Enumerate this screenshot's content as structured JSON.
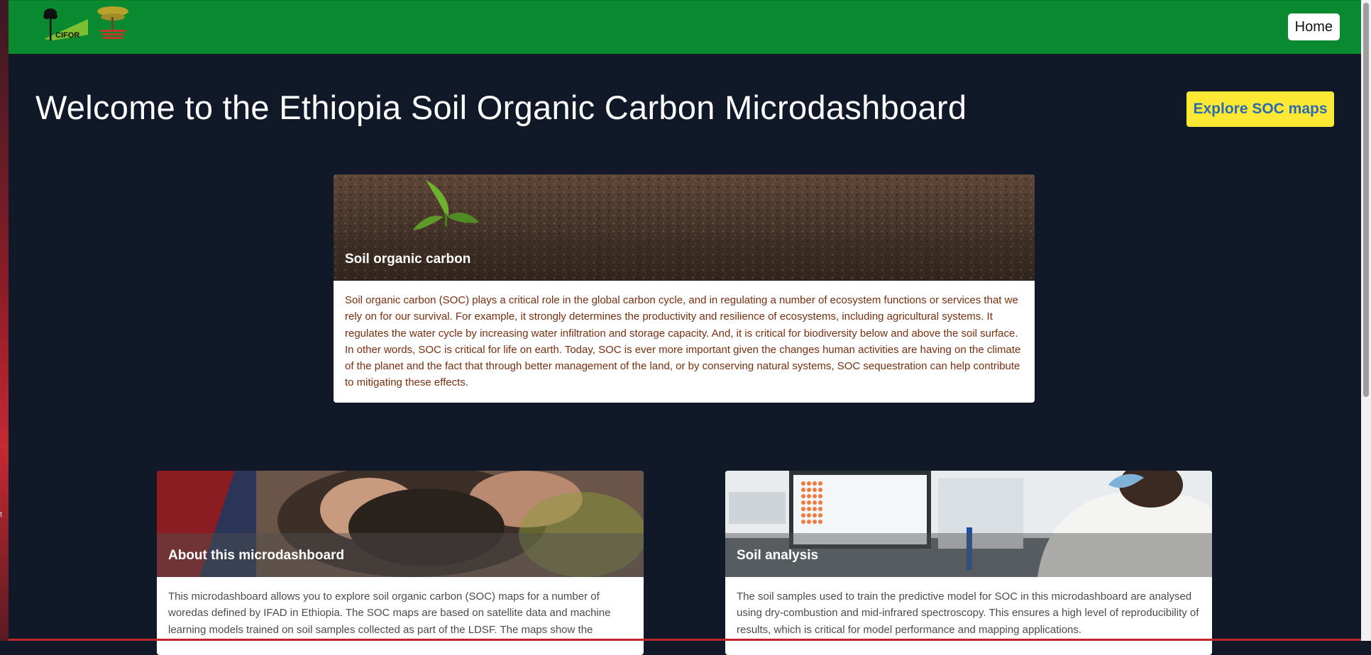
{
  "navbar": {
    "logo_cifor_text": "CIFOR",
    "home_label": "Home"
  },
  "hero": {
    "title": "Welcome to the Ethiopia Soil Organic Carbon Microdashboard",
    "explore_label": "Explore SOC maps"
  },
  "cards": {
    "soc": {
      "title": "Soil organic carbon",
      "text": "Soil organic carbon (SOC) plays a critical role in the global carbon cycle, and in regulating a number of ecosystem functions or services that we rely on for our survival. For example, it strongly determines the productivity and resilience of ecosystems, including agricultural systems. It regulates the water cycle by increasing water infiltration and storage capacity. And, it is critical for biodiversity below and above the soil surface. In other words, SOC is critical for life on earth. Today, SOC is ever more important given the changes human activities are having on the climate of the planet and the fact that through better management of the land, or by conserving natural systems, SOC sequestration can help contribute to mitigating these effects."
    },
    "about": {
      "title": "About this microdashboard",
      "text": "This microdashboard allows you to explore soil organic carbon (SOC) maps for a number of woredas defined by IFAD in Ethiopia. The SOC maps are based on satellite data and machine learning models trained on soil samples collected as part of the LDSF. The maps show the"
    },
    "analysis": {
      "title": "Soil analysis",
      "text": "The soil samples used to train the predictive model for SOC in this microdashboard are analysed using dry-combustion and mid-infrared spectroscopy. This ensures a high level of reproducibility of results, which is critical for model performance and mapping applications."
    }
  },
  "colors": {
    "navbar": "#098a30",
    "background": "#111827",
    "explore_button": "#fde833",
    "explore_text": "#2b6cb0",
    "soc_text": "#7a2e0e"
  }
}
